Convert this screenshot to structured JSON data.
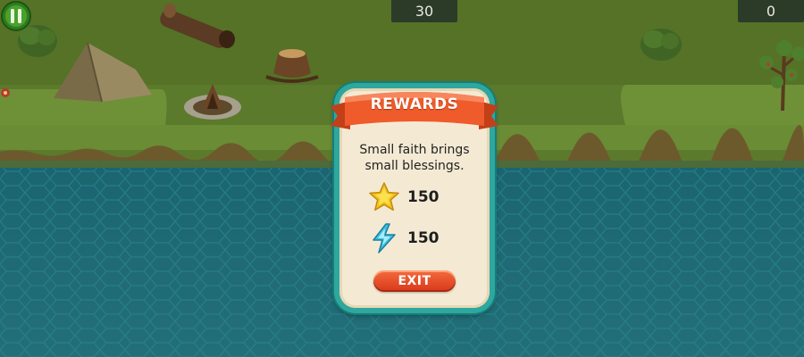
{
  "hud": {
    "counter_left": "30",
    "counter_right": "0",
    "pause_icon": "pause-icon"
  },
  "modal": {
    "title": "REWARDS",
    "message_line1": "Small faith brings",
    "message_line2": "small blessings.",
    "rewards": [
      {
        "icon": "star-icon",
        "value": "150"
      },
      {
        "icon": "lightning-icon",
        "value": "150"
      }
    ],
    "exit_label": "EXIT"
  },
  "colors": {
    "grass": "#5b7a2c",
    "water": "#1f6f78",
    "modal_frame": "#2ea79f",
    "modal_panel": "#f4ead4",
    "ribbon": "#ef5b2a",
    "exit_button": "#e24a23"
  }
}
